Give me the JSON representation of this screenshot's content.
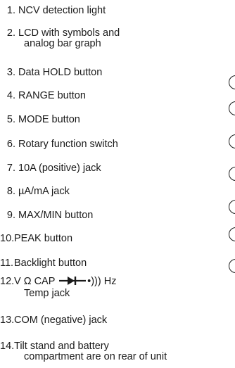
{
  "legend": {
    "items": [
      {
        "number": "1.",
        "text": "NCV detection light"
      },
      {
        "number": "2.",
        "text": "LCD with symbols and",
        "text2": "analog bar graph"
      },
      {
        "number": "3.",
        "text": "Data HOLD button"
      },
      {
        "number": "4.",
        "text": "RANGE button"
      },
      {
        "number": "5.",
        "text": "MODE button"
      },
      {
        "number": "6.",
        "text": "Rotary function switch"
      },
      {
        "number": "7.",
        "text": "10A (positive) jack"
      },
      {
        "number": "8.",
        "text": "µA/mA jack"
      },
      {
        "number": "9.",
        "text": "MAX/MIN button"
      },
      {
        "number": "10.",
        "text": "PEAK button"
      },
      {
        "number": "11.",
        "text": "Backlight button"
      },
      {
        "number": "12.",
        "text_before": "V Ω CAP",
        "text_after": "•))) Hz",
        "text2": "Temp jack",
        "icon": "diode-icon"
      },
      {
        "number": "13.",
        "text": "COM (negative) jack"
      },
      {
        "number": "14.",
        "text": "Tilt stand and battery",
        "text2": "compartment are on rear of unit"
      }
    ]
  }
}
